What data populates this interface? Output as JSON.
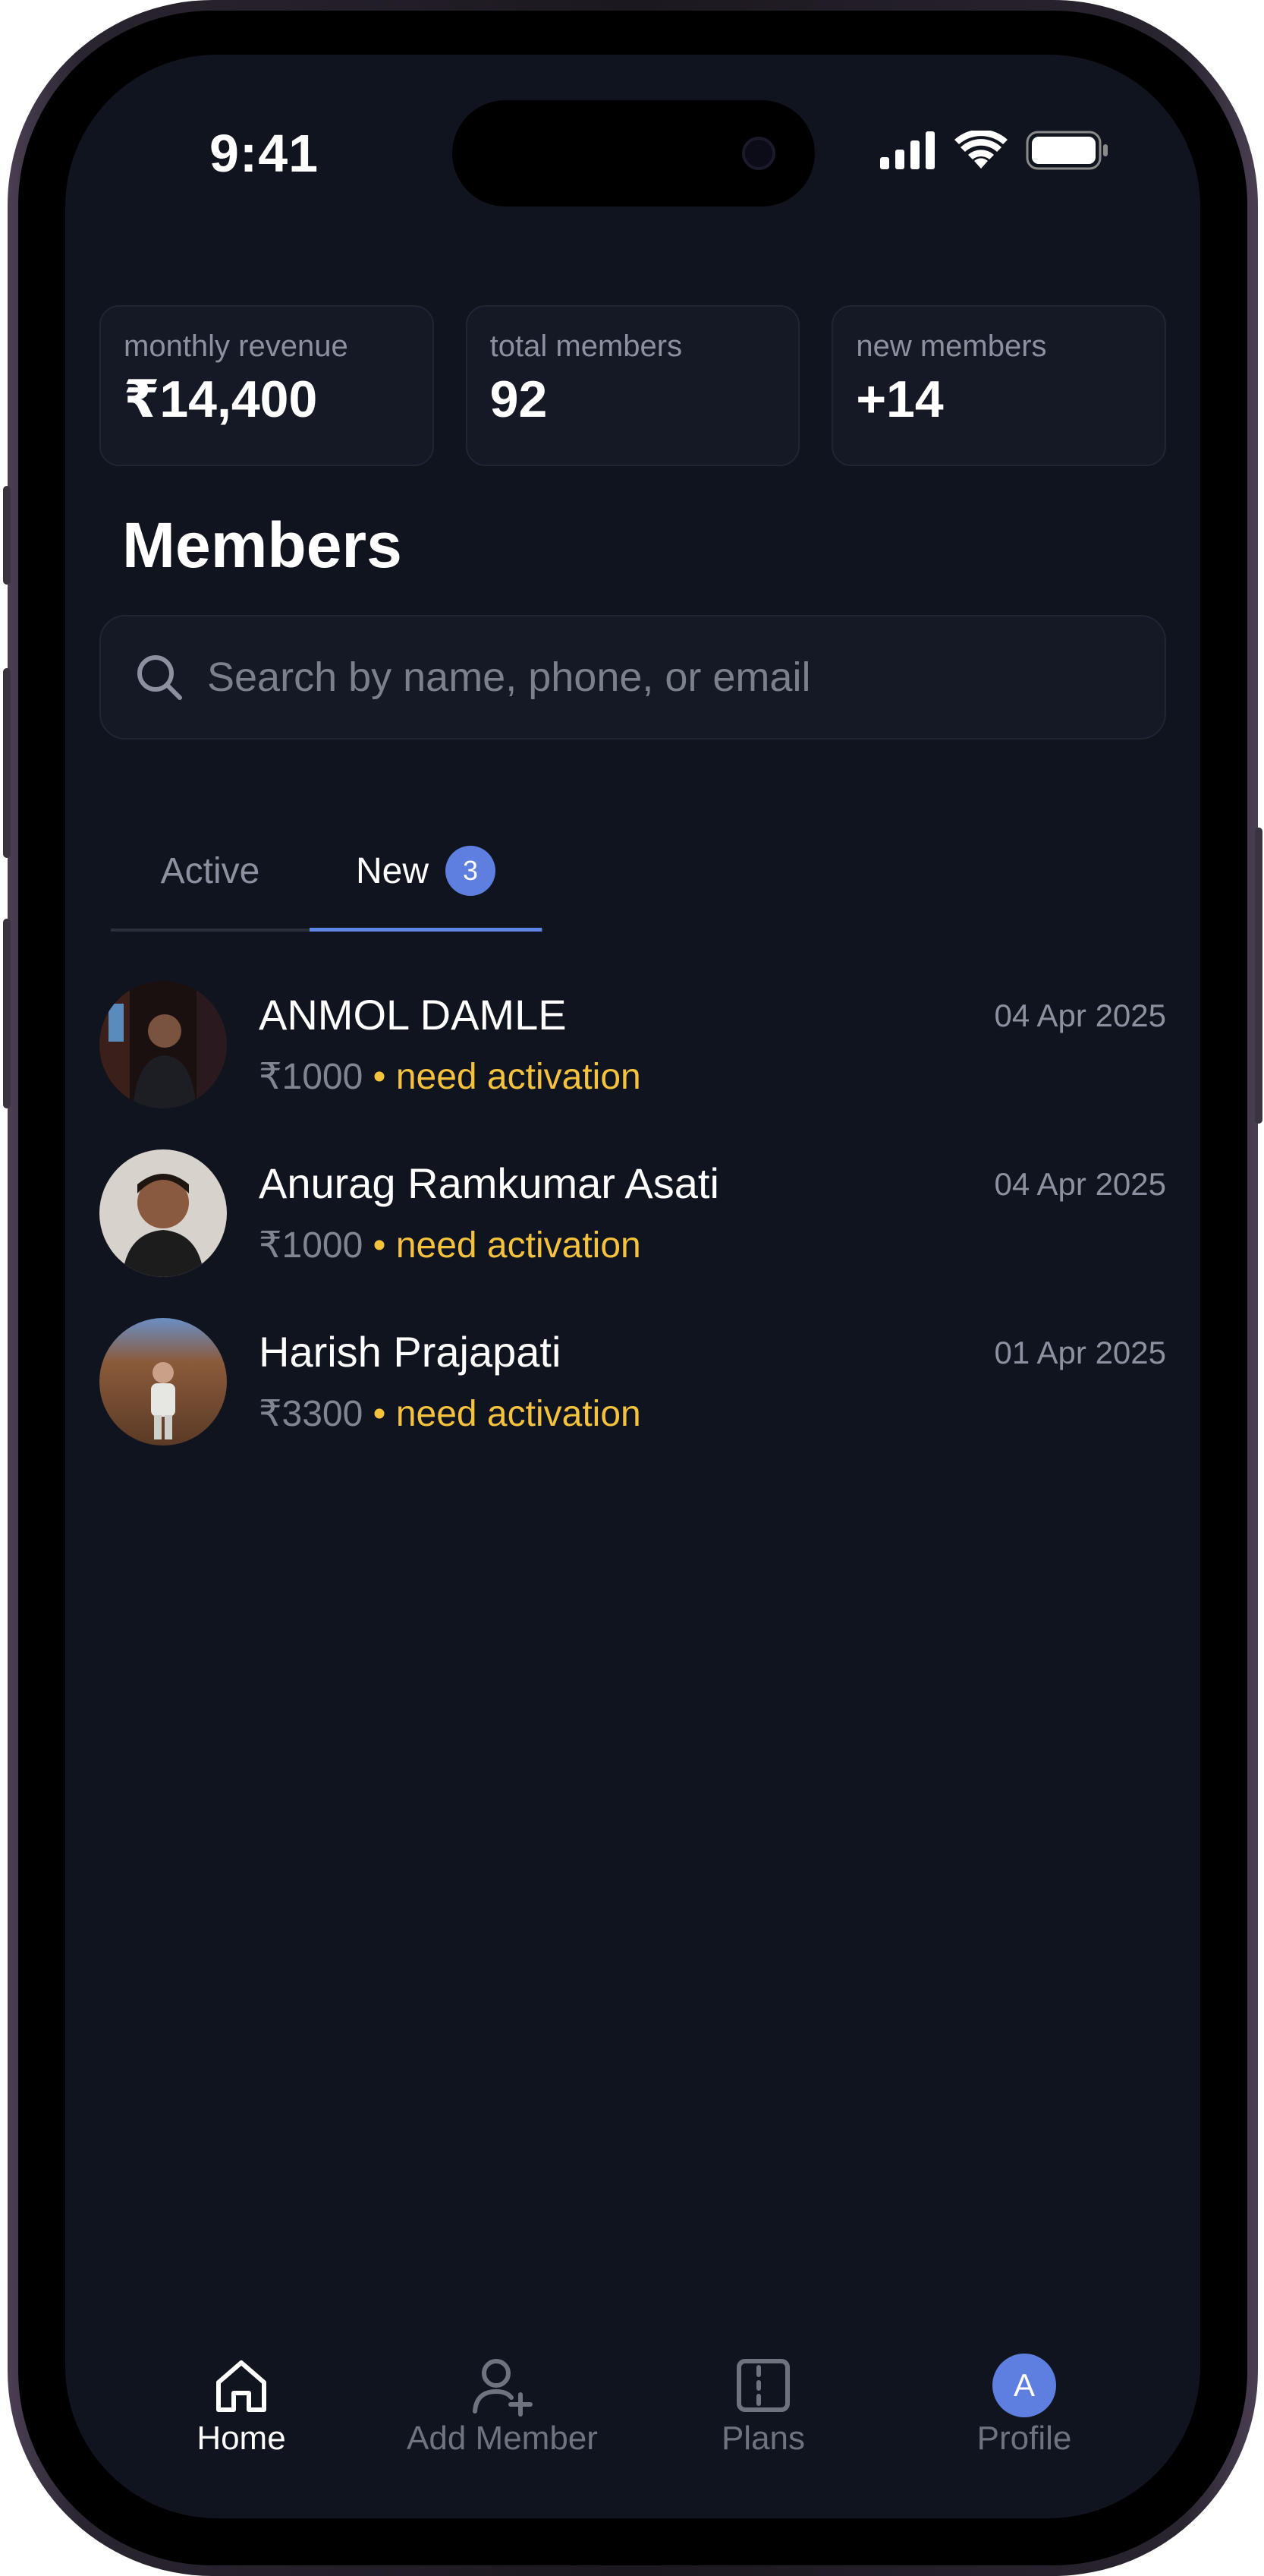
{
  "status_bar": {
    "time": "9:41"
  },
  "stats": [
    {
      "label": "monthly revenue",
      "value": "₹14,400"
    },
    {
      "label": "total members",
      "value": "92"
    },
    {
      "label": "new members",
      "value": "+14"
    }
  ],
  "page_title": "Members",
  "search": {
    "placeholder": "Search by name, phone, or email"
  },
  "tabs": [
    {
      "label": "Active"
    },
    {
      "label": "New",
      "badge": "3"
    }
  ],
  "members": [
    {
      "name": "ANMOL DAMLE",
      "price": "₹1000",
      "status": "• need activation",
      "date": "04 Apr 2025"
    },
    {
      "name": "Anurag Ramkumar Asati",
      "price": "₹1000",
      "status": "• need activation",
      "date": "04 Apr 2025"
    },
    {
      "name": "Harish Prajapati",
      "price": "₹3300",
      "status": "• need activation",
      "date": "01 Apr 2025"
    }
  ],
  "tabbar": [
    {
      "label": "Home",
      "icon": "home-icon"
    },
    {
      "label": "Add Member",
      "icon": "add-user-icon"
    },
    {
      "label": "Plans",
      "icon": "plans-icon"
    },
    {
      "label": "Profile",
      "icon": "profile-avatar",
      "initial": "A"
    }
  ],
  "colors": {
    "background": "#10141f",
    "card": "#141925",
    "accent": "#5f7fe0",
    "status_warning": "#f5c23d"
  }
}
